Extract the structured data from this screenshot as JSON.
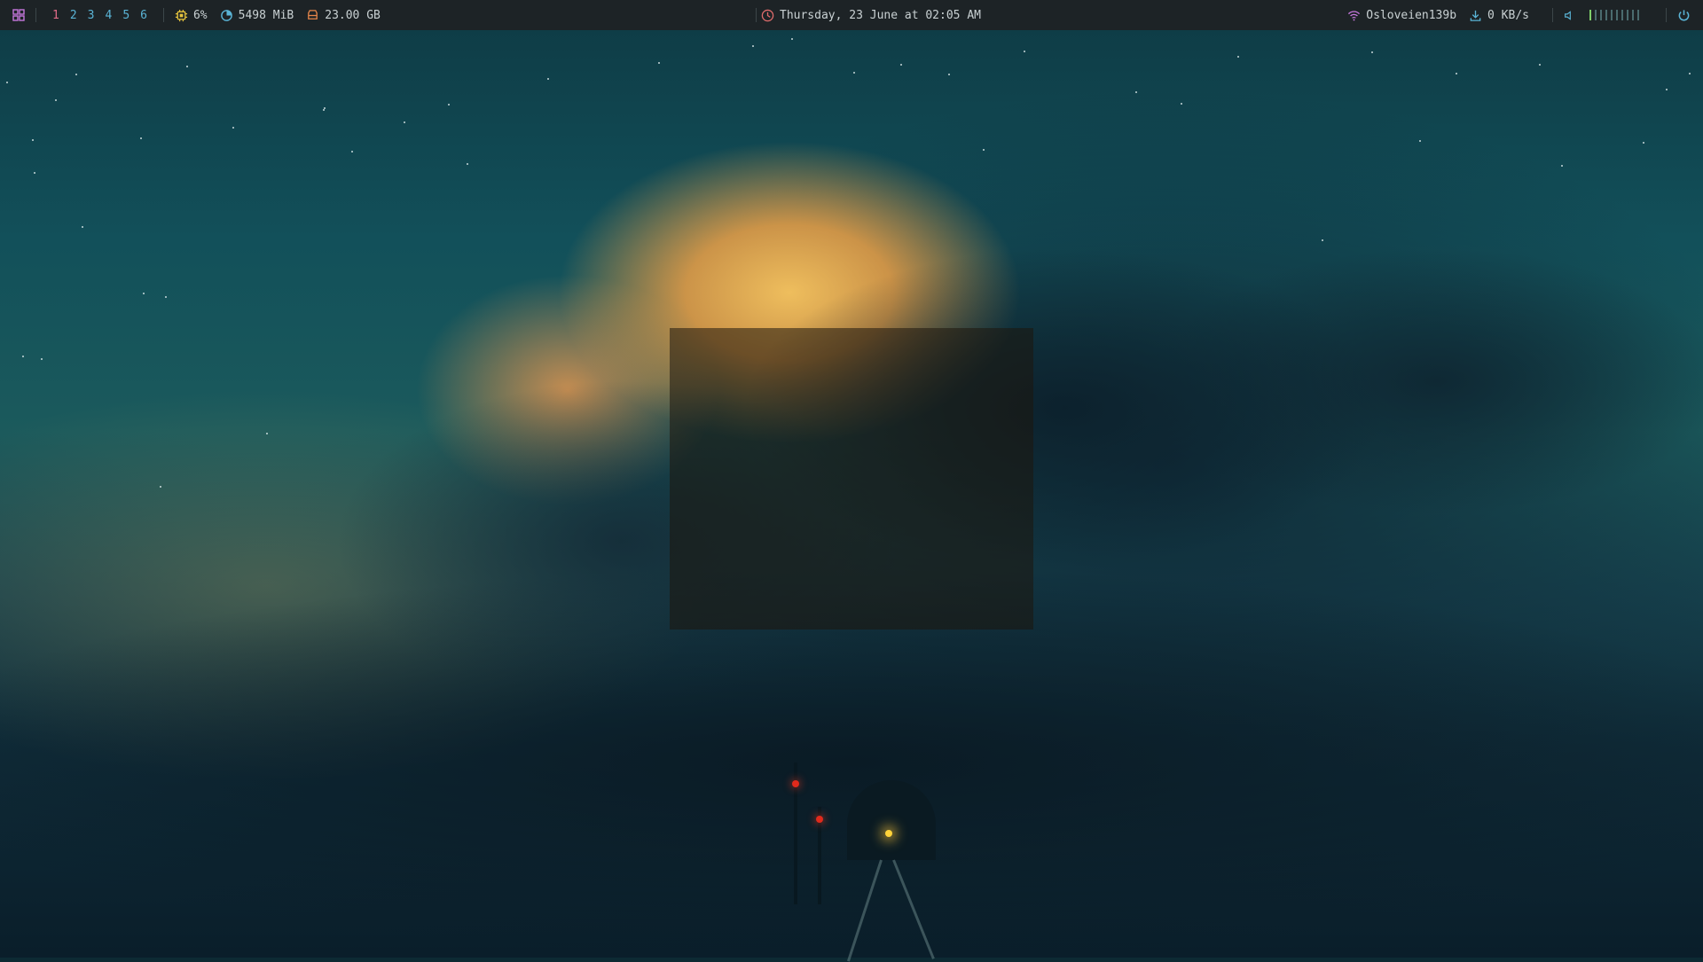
{
  "topbar": {
    "workspaces": [
      {
        "label": "1",
        "active": true
      },
      {
        "label": "2",
        "active": false
      },
      {
        "label": "3",
        "active": false
      },
      {
        "label": "4",
        "active": false
      },
      {
        "label": "5",
        "active": false
      },
      {
        "label": "6",
        "active": false
      }
    ],
    "cpu": "6%",
    "memory": "5498 MiB",
    "disk": "23.00 GB",
    "clock": "Thursday, 23 June at 02:05 AM",
    "wifi_network": "Osloveien139b",
    "download_speed": "0 KB/s",
    "volume_level": 0.1,
    "colors": {
      "bar_bg": "#1d2326",
      "workspace_active": "#e06c88",
      "workspace_inactive": "#5ab4d6",
      "cpu_icon": "#e5c33d",
      "mem_icon": "#5ab4d6",
      "disk_icon": "#e6864a",
      "clock_icon": "#e06c6c",
      "wifi_icon": "#c678dd",
      "download_icon": "#5ab4d6",
      "volume_icon": "#5ab4d6",
      "power_icon": "#5ab4d6"
    }
  }
}
